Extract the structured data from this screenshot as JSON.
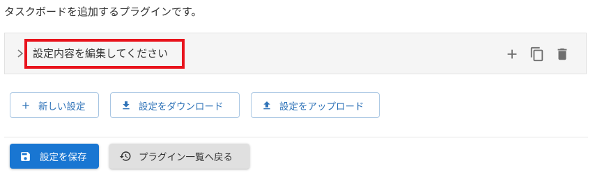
{
  "description": "タスクボードを追加するプラグインです。",
  "panel": {
    "title": "設定内容を編集してください",
    "actions": [
      "add-icon",
      "copy-icon",
      "delete-icon"
    ],
    "highlight_color": "#e8131c"
  },
  "toolbar": {
    "new_label": "新しい設定",
    "download_label": "設定をダウンロード",
    "upload_label": "設定をアップロード"
  },
  "footer": {
    "save_label": "設定を保存",
    "back_label": "プラグイン一覧へ戻る"
  },
  "colors": {
    "primary": "#1976d2",
    "outline_text": "#2f73b8",
    "panel_bg": "#f5f5f5"
  }
}
